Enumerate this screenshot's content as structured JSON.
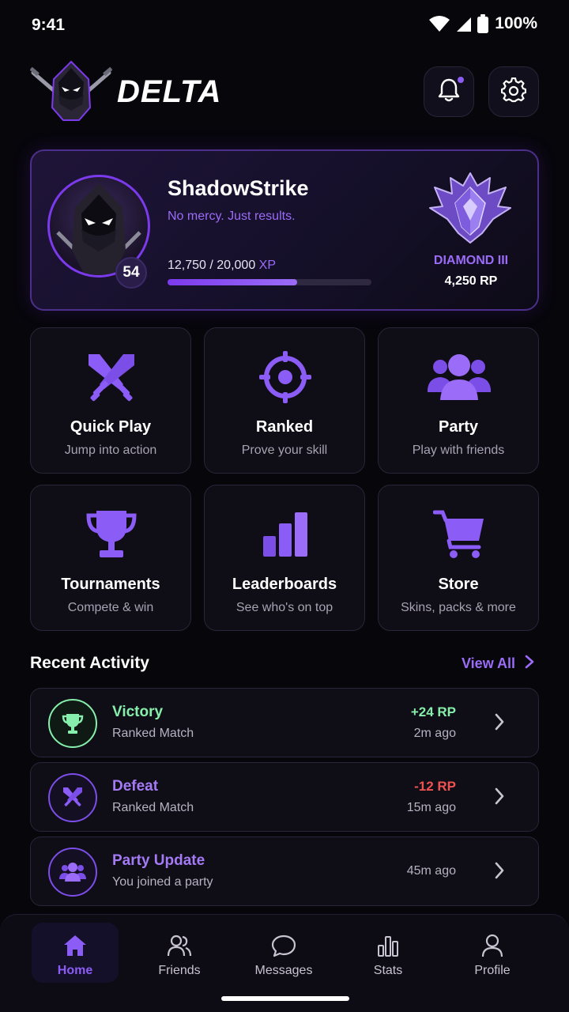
{
  "status_bar": {
    "time": "9:41",
    "battery": "100%"
  },
  "header": {
    "brand": "DELTA",
    "has_notification": true
  },
  "profile": {
    "username": "ShadowStrike",
    "tagline": "No mercy. Just results.",
    "level": "54",
    "xp_text": "12,750 / 20,000",
    "xp_unit": "XP",
    "xp_progress": 0.6375,
    "rank_name": "DIAMOND III",
    "rank_points": "4,250 RP"
  },
  "tiles": [
    {
      "title": "Quick Play",
      "subtitle": "Jump into action",
      "icon": "crossed-swords-icon"
    },
    {
      "title": "Ranked",
      "subtitle": "Prove your skill",
      "icon": "crosshair-icon"
    },
    {
      "title": "Party",
      "subtitle": "Play with friends",
      "icon": "group-icon"
    },
    {
      "title": "Tournaments",
      "subtitle": "Compete & win",
      "icon": "trophy-icon"
    },
    {
      "title": "Leaderboards",
      "subtitle": "See who's on top",
      "icon": "bar-chart-icon"
    },
    {
      "title": "Store",
      "subtitle": "Skins, packs & more",
      "icon": "cart-icon"
    }
  ],
  "recent_activity": {
    "title": "Recent Activity",
    "view_all": "View All",
    "items": [
      {
        "title": "Victory",
        "subtitle": "Ranked Match",
        "rp": "+24 RP",
        "time": "2m ago",
        "title_color": "#86efac",
        "rp_color": "#86efac"
      },
      {
        "title": "Defeat",
        "subtitle": "Ranked Match",
        "rp": "-12 RP",
        "time": "15m ago",
        "title_color": "#a47bf5",
        "rp_color": "#f05252"
      },
      {
        "title": "Party Update",
        "subtitle": "You joined a party",
        "rp": "",
        "time": "45m ago",
        "title_color": "#a47bf5",
        "rp_color": ""
      }
    ]
  },
  "nav": [
    {
      "label": "Home",
      "active": true
    },
    {
      "label": "Friends",
      "active": false
    },
    {
      "label": "Messages",
      "active": false
    },
    {
      "label": "Stats",
      "active": false
    },
    {
      "label": "Profile",
      "active": false
    }
  ],
  "colors": {
    "accent": "#8b5cf6",
    "background": "#07060b",
    "victory": "#86efac",
    "defeat": "#f05252"
  }
}
